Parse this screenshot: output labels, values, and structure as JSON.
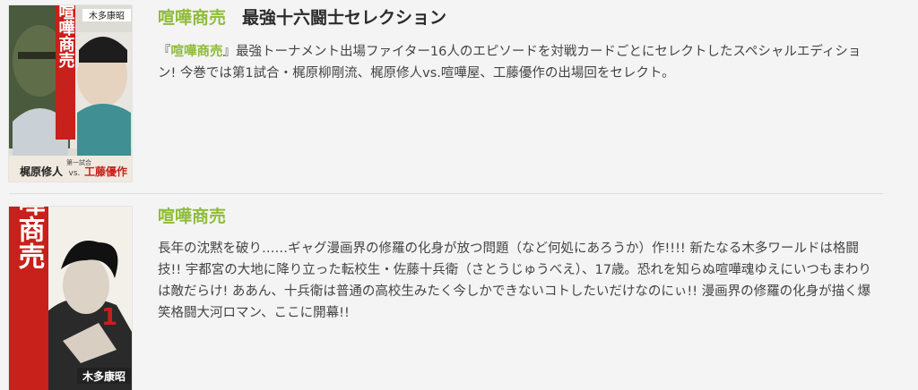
{
  "entries": [
    {
      "series": "喧嘩商売",
      "subtitle": "最強十六闘士セレクション",
      "cover": {
        "author": "木多康昭",
        "vertical_title": "喧嘩商売",
        "caption_left": "梶原修人",
        "caption_vs": "vs.",
        "caption_right": "工藤優作",
        "small_label": "第一試合"
      },
      "desc_open": "『",
      "desc_highlight": "喧嘩商売",
      "desc_rest": "』最強トーナメント出場ファイター16人のエピソードを対戦カードごとにセレクトしたスペシャルエディション! 今巻では第1試合・梶原柳剛流、梶原修人vs.喧嘩屋、工藤優作の出場回をセレクト。"
    },
    {
      "series": "喧嘩商売",
      "cover": {
        "author": "木多康昭",
        "vertical_title": "喧嘩商売",
        "volume_number": "1"
      },
      "description": "長年の沈黙を破り……ギャグ漫画界の修羅の化身が放つ問題（など何処にあろうか）作!!!! 新たなる木多ワールドは格闘技!! 宇都宮の大地に降り立った転校生・佐藤十兵衛（さとうじゅうべえ）、17歳。恐れを知らぬ喧嘩魂ゆえにいつもまわりは敵だらけ! ああん、十兵衛は普通の高校生みたく今しかできないコトしたいだけなのにぃ!! 漫画界の修羅の化身が描く爆笑格闘大河ロマン、ここに開幕!!"
    }
  ],
  "colors": {
    "accent_green": "#8fbc3a",
    "cover_red": "#c8201a",
    "background": "#f4f4f4"
  }
}
